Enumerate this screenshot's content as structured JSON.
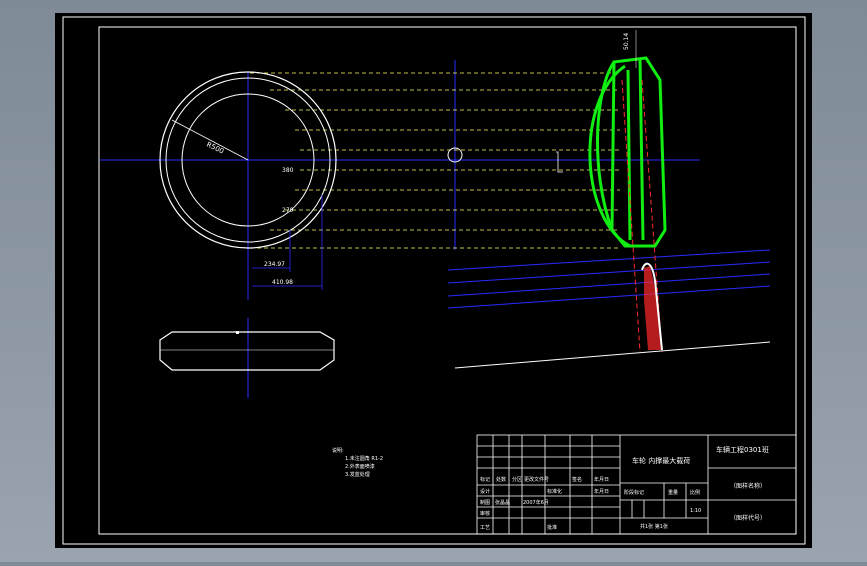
{
  "drawing": {
    "dimensions": {
      "radius_label": "R500",
      "center_label": "380",
      "inner_label": "270",
      "width_small": "234.97",
      "width_large": "410.98",
      "vertical_top": "50.14"
    },
    "notes": {
      "heading": "说明:",
      "line1": "1.未注圆角 R1-2",
      "line2": "2.外表面喷漆",
      "line3": "3.发蓝处理"
    },
    "title_block": {
      "part_name": "车轮 内撑最大载荷",
      "school": "车辆工程0301班",
      "sheet_name": "（图样名称）",
      "sheet_code": "（图样代号）",
      "row1": [
        "标记",
        "处数",
        "分区",
        "更改文件号",
        "签名",
        "年月日"
      ],
      "row2": [
        "设计",
        "",
        "标准化",
        "",
        "",
        "年月日"
      ],
      "row3": [
        "制图",
        "张晶晶",
        "2007年6月",
        "",
        "",
        ""
      ],
      "row4": [
        "审核",
        "",
        "",
        "",
        "",
        ""
      ],
      "row5": [
        "工艺",
        "",
        "批准",
        "",
        "",
        ""
      ],
      "stage_labels": [
        "阶段标记",
        "重量",
        "比例"
      ],
      "scale": "1:10",
      "sheets": "共1张   第1张"
    },
    "colors": {
      "background": "#000000",
      "frame": "#ffffff",
      "centerline": "#2a2aff",
      "hidden": "#ffff66",
      "highlight": "#11ee11",
      "section": "#ff2a2a"
    }
  }
}
